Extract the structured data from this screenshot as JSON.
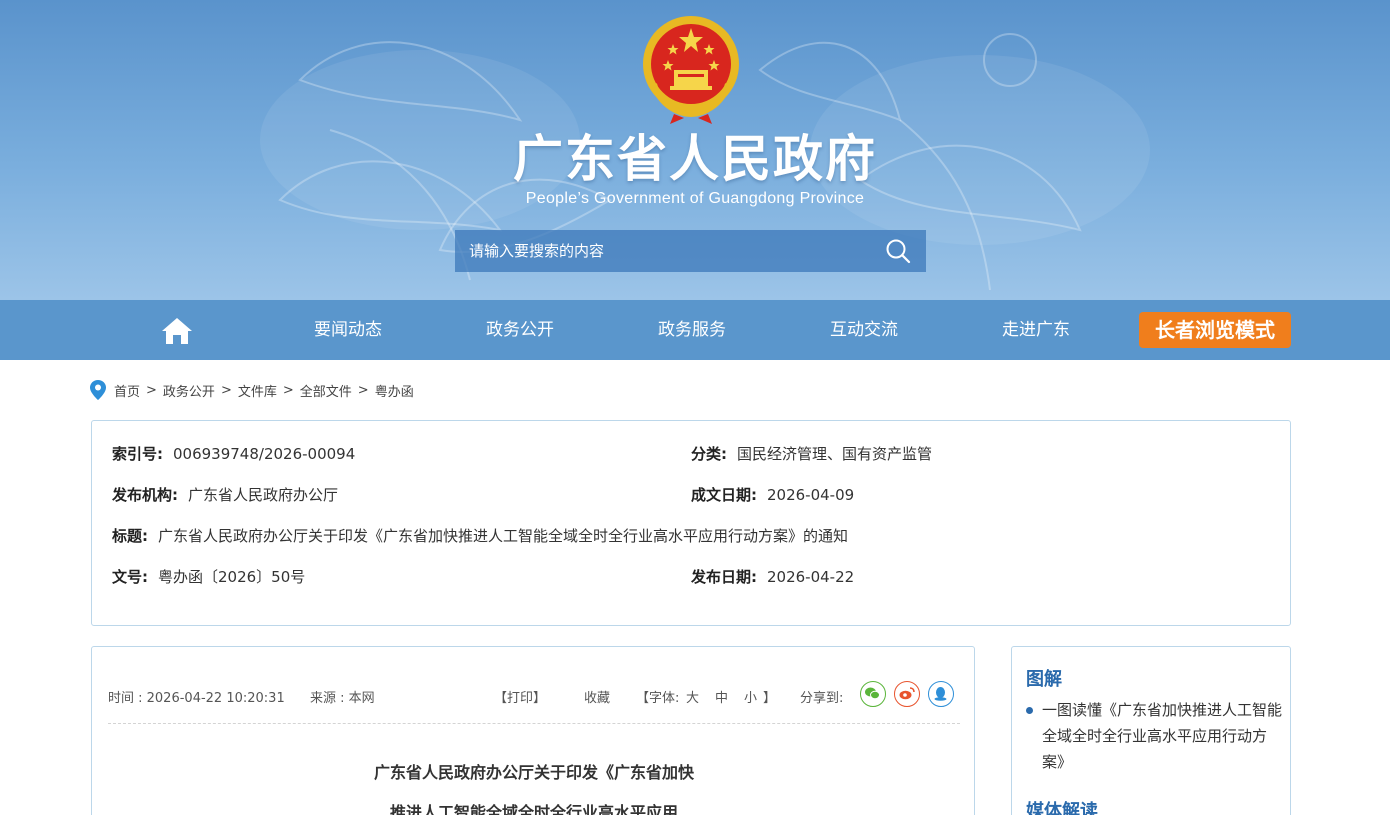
{
  "header": {
    "title": "广东省人民政府",
    "subtitle": "People’s Government of Guangdong Province",
    "search_placeholder": "请输入要搜索的内容"
  },
  "nav": {
    "items": [
      "要闻动态",
      "政务公开",
      "政务服务",
      "互动交流",
      "走进广东"
    ],
    "elder_mode": "长者浏览模式"
  },
  "breadcrumb": [
    "首页",
    "政务公开",
    "文件库",
    "全部文件",
    "粤办函"
  ],
  "meta": {
    "index_label": "索引号:",
    "index_value": "006939748/2026-00094",
    "category_label": "分类:",
    "category_value": "国民经济管理、国有资产监管",
    "publisher_label": "发布机构:",
    "publisher_value": "广东省人民政府办公厅",
    "created_label": "成文日期:",
    "created_value": "2026-04-09",
    "title_label": "标题:",
    "title_value": "广东省人民政府办公厅关于印发《广东省加快推进人工智能全域全时全行业高水平应用行动方案》的通知",
    "docno_label": "文号:",
    "docno_value": "粤办函〔2026〕50号",
    "published_label": "发布日期:",
    "published_value": "2026-04-22"
  },
  "article": {
    "time": "时间 : 2026-04-22 10:20:31",
    "source": "来源 : 本网",
    "print": "【打印】",
    "favorite": "收藏",
    "font_open": "【字体:",
    "font_large": "大",
    "font_medium": "中",
    "font_small": "小",
    "font_close": "】",
    "share_label": "分享到:",
    "title_line1": "广东省人民政府办公厅关于印发《广东省加快",
    "title_line2": "推进人工智能全域全时全行业高水平应用"
  },
  "sidebar": {
    "heading1": "图解",
    "item1": "一图读懂《广东省加快推进人工智能全域全时全行业高水平应用行动方案》",
    "heading2": "媒体解读"
  },
  "colors": {
    "nav_bg": "#5a96cc",
    "elder_btn": "#f07e1c",
    "accent_blue": "#2a6aac",
    "wechat": "#5ab53a",
    "weibo": "#e8542e",
    "qq": "#2e8fd8"
  },
  "icons": [
    "national-emblem-icon",
    "search-icon",
    "home-icon",
    "location-pin-icon",
    "wechat-icon",
    "weibo-icon",
    "qq-icon"
  ]
}
